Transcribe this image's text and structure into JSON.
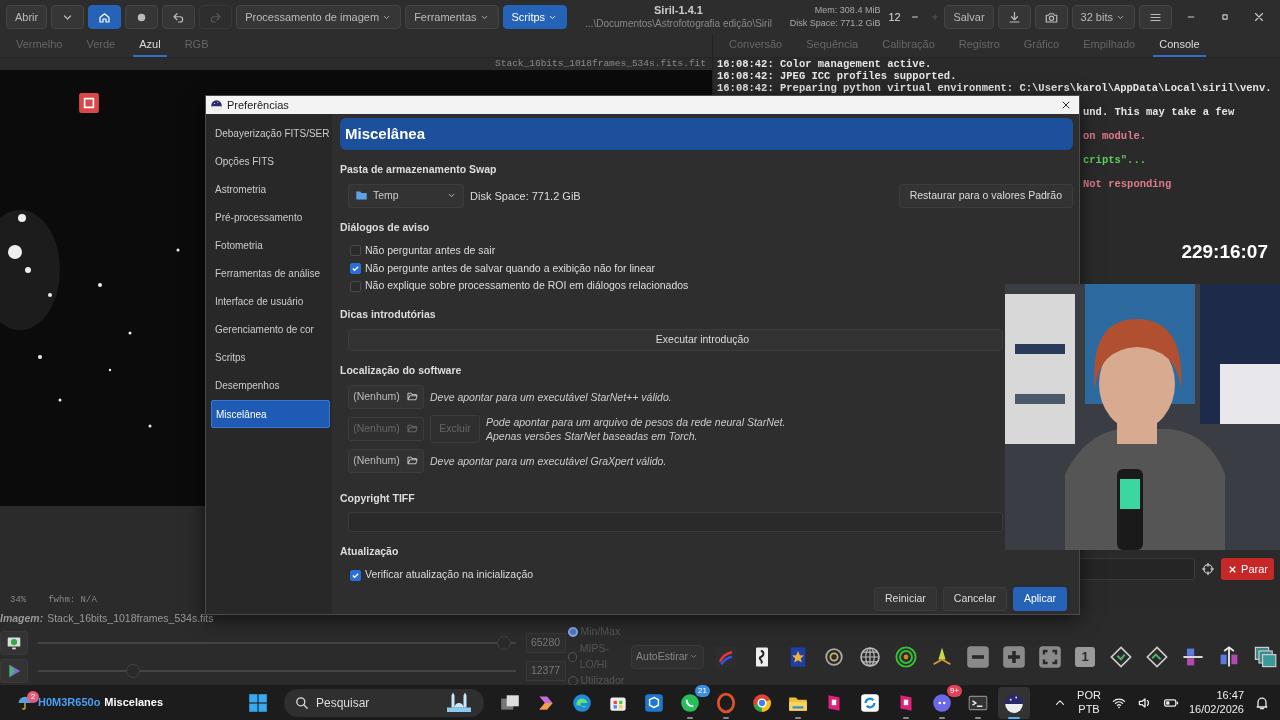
{
  "titlebar": {
    "title": "Siril-1.4.1",
    "path": "...\\Documentos\\Astrofotografia edição\\Siril",
    "mem": "Mem: 308.4 MiB",
    "disk": "Disk Space: 771.2 GiB",
    "spin": "12"
  },
  "toolbar_left": [
    {
      "kind": "text",
      "label": "Abrir",
      "selected": false,
      "disabled": false
    },
    {
      "kind": "caret",
      "selected": false,
      "disabled": false
    },
    {
      "kind": "home",
      "selected": true,
      "disabled": false
    },
    {
      "kind": "record",
      "selected": false,
      "disabled": false
    },
    {
      "kind": "undo",
      "selected": false,
      "disabled": false
    },
    {
      "kind": "redo",
      "selected": false,
      "disabled": true
    },
    {
      "kind": "menu",
      "label": "Processamento de imagem",
      "selected": false,
      "disabled": false
    },
    {
      "kind": "menu",
      "label": "Ferramentas",
      "selected": false,
      "disabled": false
    },
    {
      "kind": "menu",
      "label": "Scritps",
      "selected": true,
      "disabled": false
    }
  ],
  "toolbar_right": [
    {
      "kind": "text",
      "label": "Salvar"
    },
    {
      "kind": "download"
    },
    {
      "kind": "camera"
    },
    {
      "kind": "menu",
      "label": "32 bits"
    },
    {
      "kind": "hamburger"
    }
  ],
  "channel_tabs": [
    {
      "label": "Vermelho",
      "selected": false
    },
    {
      "label": "Verde",
      "selected": false
    },
    {
      "label": "Azul",
      "selected": true
    },
    {
      "label": "RGB",
      "selected": false
    }
  ],
  "image": {
    "filename": "Stack_16bits_1018frames_534s.fits.fit",
    "zoom": "34%",
    "fwhm": "fwhm: N/A"
  },
  "panel_tabs": [
    {
      "label": "Conversão",
      "selected": false
    },
    {
      "label": "Sequência",
      "selected": false
    },
    {
      "label": "Calibração",
      "selected": false
    },
    {
      "label": "Registro",
      "selected": false
    },
    {
      "label": "Gráfico",
      "selected": false
    },
    {
      "label": "Empilhado",
      "selected": false
    },
    {
      "label": "Console",
      "selected": true
    }
  ],
  "console": {
    "lines": [
      {
        "kind": "log",
        "text": "16:08:42: Color management active.",
        "color": "#e6e6e6"
      },
      {
        "kind": "log",
        "text": "16:08:42: JPEG ICC profiles supported.",
        "color": "#e6e6e6"
      },
      {
        "kind": "log",
        "text": "16:08:42: Preparing python virtual environment: C:\\Users\\karol\\AppData\\Local\\siril\\venv.",
        "color": "#e6e6e6"
      },
      {
        "kind": "tail",
        "text": "und. This may take a few",
        "color": "#e6e6e6"
      },
      {
        "kind": "tail",
        "text": "on module.",
        "color": "#e07b8a"
      },
      {
        "kind": "tail",
        "text": "cripts\"...",
        "color": "#5fcf5f"
      },
      {
        "kind": "tail",
        "text": "Not responding",
        "color": "#e07b8a"
      }
    ],
    "stop_button": "Parar"
  },
  "stopwatch": "229:16:07",
  "info": {
    "label": "Imagem:",
    "file": "Stack_16bits_1018frames_534s.fits"
  },
  "sliders": [
    {
      "level": 0.99,
      "value": "65280"
    },
    {
      "level": 0.19,
      "value": "12377"
    }
  ],
  "scale_modes": [
    {
      "label": "Min/Max",
      "selected": true
    },
    {
      "label": "MIPS-LO/HI",
      "selected": false
    },
    {
      "label": "Utilizador",
      "selected": false
    }
  ],
  "stretch": "AutoEstirar",
  "tools": [
    {
      "kind": "link"
    },
    {
      "kind": "script"
    },
    {
      "kind": "star"
    },
    {
      "kind": "dial"
    },
    {
      "kind": "globe"
    },
    {
      "kind": "target"
    },
    {
      "kind": "rocket"
    },
    {
      "kind": "minus"
    },
    {
      "kind": "plus"
    },
    {
      "kind": "fit"
    },
    {
      "kind": "one",
      "label": "1"
    },
    {
      "kind": "rotl"
    },
    {
      "kind": "rotr"
    },
    {
      "kind": "mirror"
    },
    {
      "kind": "flip"
    },
    {
      "kind": "gallery"
    }
  ],
  "dialog": {
    "title": "Preferências",
    "nav": [
      {
        "label": "Debayerização FITS/SER",
        "selected": false
      },
      {
        "label": "Opções FITS",
        "selected": false
      },
      {
        "label": "Astrometria",
        "selected": false
      },
      {
        "label": "Pré-processamento",
        "selected": false
      },
      {
        "label": "Fotometria",
        "selected": false
      },
      {
        "label": "Ferramentas de análise",
        "selected": false
      },
      {
        "label": "Interface de usuário",
        "selected": false
      },
      {
        "label": "Gerenciamento de cor",
        "selected": false
      },
      {
        "label": "Scritps",
        "selected": false
      },
      {
        "label": "Desempenhos",
        "selected": false
      },
      {
        "label": "Miscelânea",
        "selected": true
      }
    ],
    "heading": "Miscelânea",
    "sections": [
      {
        "kind": "swap",
        "title": "Pasta de armazenamento Swap",
        "folder": "Temp",
        "disk": "Disk Space: 771.2 GiB",
        "button": "Restaurar para o valores Padrão"
      },
      {
        "kind": "checks",
        "title": "Diálogos de aviso",
        "items": [
          {
            "label": "Não perguntar antes de sair",
            "checked": false
          },
          {
            "label": "Não pergunte antes de salvar quando a exibição não for linear",
            "checked": true
          },
          {
            "label": "Não explique sobre processamento de ROI em diálogos relacionados",
            "checked": false
          }
        ]
      },
      {
        "kind": "action",
        "title": "Dicas introdutórias",
        "button": "Executar introdução"
      },
      {
        "kind": "paths",
        "title": "Localização do software",
        "rows": [
          {
            "value": "(Nenhum)",
            "disabled": false,
            "hints": [
              "Deve apontar para um executável StarNet++ válido."
            ]
          },
          {
            "value": "(Nenhum)",
            "disabled": true,
            "extra": "Excluir",
            "hints": [
              "Pode apontar para um arquivo de pesos da rede neural StarNet.",
              "Apenas versões StarNet baseadas em Torch."
            ]
          },
          {
            "value": "(Nenhum)",
            "disabled": false,
            "hints": [
              "Deve apontar para um executável GraXpert válido."
            ]
          }
        ]
      },
      {
        "kind": "field",
        "title": "Copyright TIFF"
      },
      {
        "kind": "checks",
        "title": "Atualização",
        "items": [
          {
            "label": "Verificar atualização na inicialização",
            "checked": true
          }
        ]
      }
    ],
    "buttons": [
      {
        "label": "Reiniciar",
        "primary": false
      },
      {
        "label": "Cancelar",
        "primary": false
      },
      {
        "label": "Aplicar",
        "primary": true
      }
    ]
  },
  "taskbar": {
    "weather_badge": "2",
    "user": "H0M3R650o",
    "window_title": "Miscelanes",
    "search": "Pesquisar",
    "apps": [
      {
        "kind": "taskview",
        "running": false,
        "selected": false
      },
      {
        "kind": "copilot",
        "running": false,
        "selected": false
      },
      {
        "kind": "edge",
        "running": false,
        "selected": false
      },
      {
        "kind": "store",
        "running": false,
        "selected": false
      },
      {
        "kind": "cube",
        "running": false,
        "selected": false
      },
      {
        "kind": "whatsapp",
        "badge": "21",
        "running": true,
        "selected": false
      },
      {
        "kind": "opera",
        "running": true,
        "selected": false
      },
      {
        "kind": "chrome",
        "running": false,
        "selected": false
      },
      {
        "kind": "explorer",
        "running": true,
        "selected": false
      },
      {
        "kind": "pink",
        "running": false,
        "selected": false
      },
      {
        "kind": "sync",
        "running": false,
        "selected": false
      },
      {
        "kind": "pink",
        "running": true,
        "selected": false
      },
      {
        "kind": "discord",
        "badge": "9+",
        "running": true,
        "selected": false
      },
      {
        "kind": "terminal",
        "running": true,
        "selected": false
      },
      {
        "kind": "siril",
        "running": true,
        "selected": true
      }
    ],
    "lang": "POR",
    "layout": "PTB",
    "time": "16:47",
    "date": "16/02/2026"
  }
}
